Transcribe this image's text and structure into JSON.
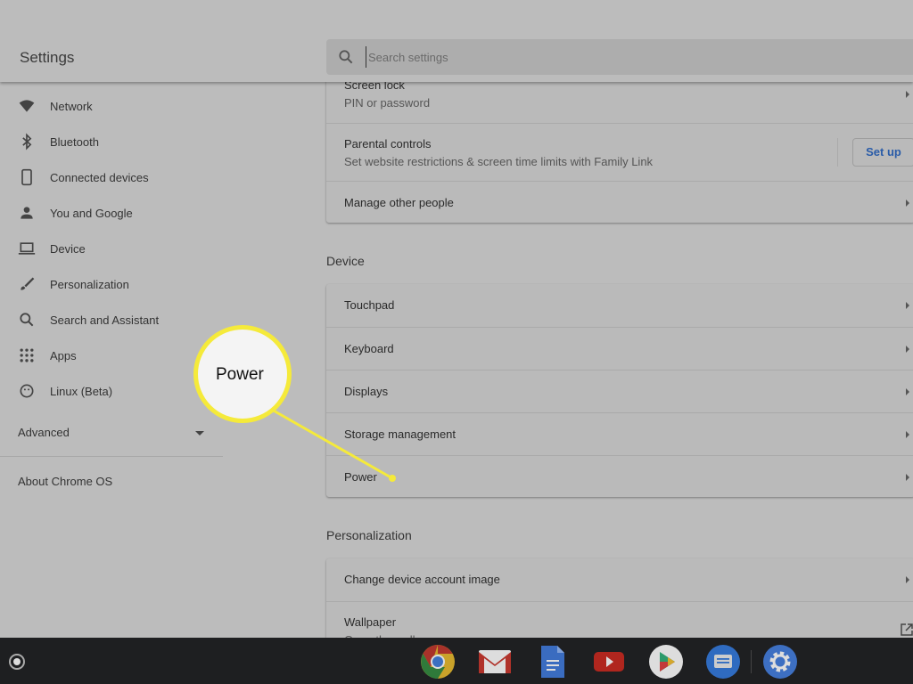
{
  "header": {
    "title": "Settings",
    "search_placeholder": "Search settings",
    "search_icon": "search-icon"
  },
  "sidebar": {
    "items": [
      {
        "label": "Network",
        "icon": "wifi-icon"
      },
      {
        "label": "Bluetooth",
        "icon": "bluetooth-icon"
      },
      {
        "label": "Connected devices",
        "icon": "phone-icon"
      },
      {
        "label": "You and Google",
        "icon": "person-icon"
      },
      {
        "label": "Device",
        "icon": "laptop-icon"
      },
      {
        "label": "Personalization",
        "icon": "brush-icon"
      },
      {
        "label": "Search and Assistant",
        "icon": "search-icon"
      },
      {
        "label": "Apps",
        "icon": "apps-grid-icon"
      },
      {
        "label": "Linux (Beta)",
        "icon": "penguin-icon"
      }
    ],
    "advanced": "Advanced",
    "about": "About Chrome OS"
  },
  "people": {
    "screen_lock": {
      "title": "Screen lock",
      "subtitle": "PIN or password"
    },
    "parental": {
      "title": "Parental controls",
      "subtitle": "Set website restrictions & screen time limits with Family Link",
      "button": "Set up"
    },
    "manage": {
      "title": "Manage other people"
    }
  },
  "device": {
    "heading": "Device",
    "items": [
      "Touchpad",
      "Keyboard",
      "Displays",
      "Storage management",
      "Power"
    ]
  },
  "personalization": {
    "heading": "Personalization",
    "items": [
      {
        "title": "Change device account image"
      },
      {
        "title": "Wallpaper",
        "subtitle": "Open the wallpaper app"
      }
    ]
  },
  "callout": {
    "text": "Power",
    "color": "#f5ea3a"
  },
  "shelf": {
    "apps": [
      "Chrome",
      "Gmail",
      "Docs",
      "YouTube",
      "Play Store",
      "Messages",
      "Settings"
    ]
  }
}
